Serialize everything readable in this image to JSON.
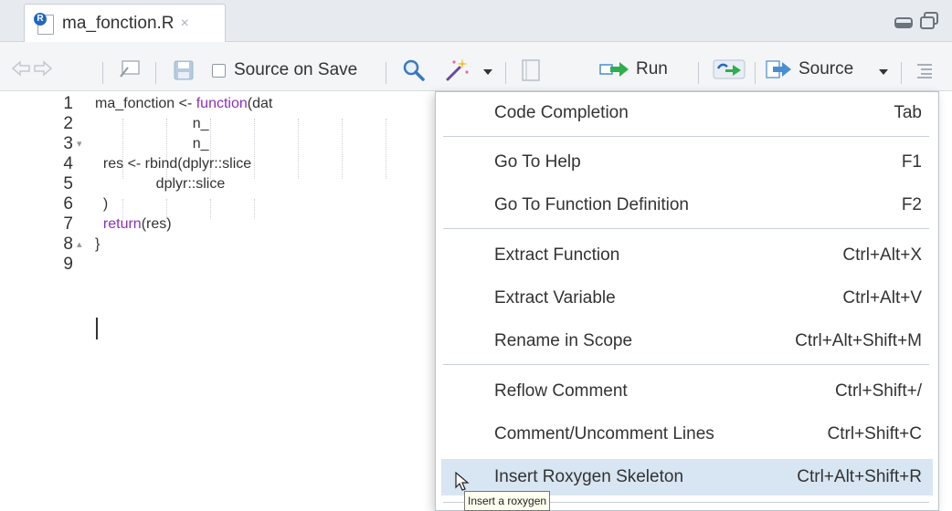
{
  "tab": {
    "label": "ma_fonction.R",
    "close": "×",
    "badge": "R"
  },
  "toolbar": {
    "source_on_save": "Source on Save",
    "run": "Run",
    "source": "Source"
  },
  "editor": {
    "lines": [
      {
        "num": "1",
        "fold": "",
        "code": "ma_fonction <- function(dat"
      },
      {
        "num": "2",
        "fold": "",
        "code": "                        n_"
      },
      {
        "num": "3",
        "fold": "▾",
        "code": "                        n_"
      },
      {
        "num": "4",
        "fold": "",
        "code": "  res <- rbind(dplyr::slice"
      },
      {
        "num": "5",
        "fold": "",
        "code": "               dplyr::slice"
      },
      {
        "num": "6",
        "fold": "",
        "code": "  )"
      },
      {
        "num": "7",
        "fold": "",
        "code": "  return(res)"
      },
      {
        "num": "8",
        "fold": "▴",
        "code": "}"
      },
      {
        "num": "9",
        "fold": "",
        "code": ""
      }
    ],
    "keyword_colors": {
      "keyword": "#8b30b8"
    }
  },
  "menu": {
    "items": [
      {
        "label": "Code Completion",
        "shortcut": "Tab"
      },
      {
        "label": "Go To Help",
        "shortcut": "F1"
      },
      {
        "label": "Go To Function Definition",
        "shortcut": "F2"
      },
      {
        "label": "Extract Function",
        "shortcut": "Ctrl+Alt+X"
      },
      {
        "label": "Extract Variable",
        "shortcut": "Ctrl+Alt+V"
      },
      {
        "label": "Rename in Scope",
        "shortcut": "Ctrl+Alt+Shift+M"
      },
      {
        "label": "Reflow Comment",
        "shortcut": "Ctrl+Shift+/"
      },
      {
        "label": "Comment/Uncomment Lines",
        "shortcut": "Ctrl+Shift+C"
      },
      {
        "label": "Insert Roxygen Skeleton",
        "shortcut": "Ctrl+Alt+Shift+R"
      }
    ],
    "highlighted": "Insert Roxygen Skeleton",
    "highlight_color": "#d8e6f3"
  },
  "tooltip": {
    "text": "Insert a roxygen"
  }
}
